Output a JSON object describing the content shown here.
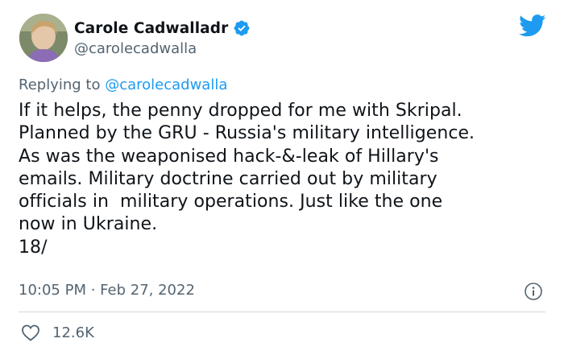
{
  "author": {
    "display_name": "Carole Cadwalladr",
    "handle": "@carolecadwalla",
    "verified": true
  },
  "reply": {
    "prefix": "Replying to ",
    "mention": "@carolecadwalla"
  },
  "tweet": {
    "text": "If it helps, the penny dropped for me with Skripal.\nPlanned by the GRU - Russia's military intelligence.\nAs was the weaponised hack-&-leak of Hillary's\nemails. Military doctrine carried out by military\nofficials in  military operations. Just like the one\nnow in Ukraine.\n18/"
  },
  "meta": {
    "timestamp": "10:05 PM · Feb 27, 2022"
  },
  "engagement": {
    "likes": "12.6K"
  },
  "icons": {
    "brand": "twitter-bird-icon",
    "verified": "verified-badge-icon",
    "info": "info-icon",
    "like": "heart-icon"
  },
  "colors": {
    "accent": "#1d9bf0",
    "text": "#0f1419",
    "secondary": "#536471",
    "divider": "#cfd9de"
  }
}
